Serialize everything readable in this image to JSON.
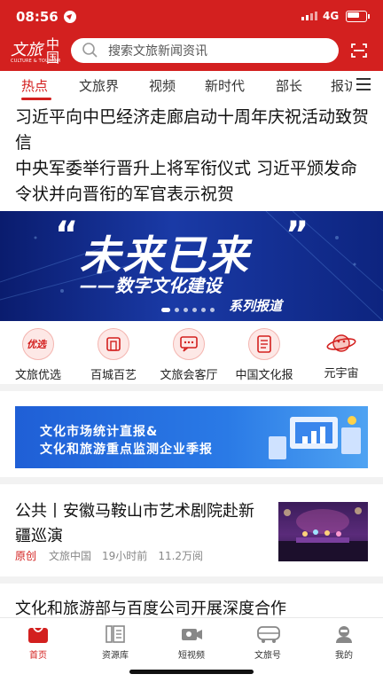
{
  "status": {
    "time": "08:56",
    "network": "4G"
  },
  "header": {
    "logo_cn": "文旅",
    "logo_cn2": "中国",
    "logo_en": "CULTURE & TOURISM",
    "search_placeholder": "搜索文旅新闻资讯"
  },
  "tabs": [
    {
      "label": "热点"
    },
    {
      "label": "文旅界"
    },
    {
      "label": "视频"
    },
    {
      "label": "新时代"
    },
    {
      "label": "部长"
    },
    {
      "label": "报访"
    }
  ],
  "headlines": [
    {
      "text": "习近平向中巴经济走廊启动十周年庆祝活动致贺信"
    },
    {
      "text": "中央军委举行晋升上将军衔仪式 习近平颁发命令状并向晋衔的军官表示祝贺"
    }
  ],
  "banner": {
    "title": "未来已来",
    "subtitle": "——数字文化建设",
    "tail": "系列报道"
  },
  "quick_links": [
    {
      "label": "文旅优选",
      "badge": "优选"
    },
    {
      "label": "百城百艺"
    },
    {
      "label": "文旅会客厅"
    },
    {
      "label": "中国文化报"
    },
    {
      "label": "元宇宙"
    }
  ],
  "ad": {
    "line1": "文化市场统计直报&",
    "line2": "文化和旅游重点监测企业季报"
  },
  "article": {
    "title": "公共丨安徽马鞍山市艺术剧院赴新疆巡演",
    "tag": "原创",
    "source": "文旅中国",
    "time": "19小时前",
    "views": "11.2万阅"
  },
  "article2": {
    "title": "文化和旅游部与百度公司开展深度合作"
  },
  "bottom_nav": [
    {
      "label": "首页"
    },
    {
      "label": "资源库"
    },
    {
      "label": "短视频"
    },
    {
      "label": "文旅号"
    },
    {
      "label": "我的"
    }
  ],
  "colors": {
    "brand_red": "#d3201f",
    "ad_blue": "#2a7ae6",
    "banner_navy": "#0d247f"
  }
}
